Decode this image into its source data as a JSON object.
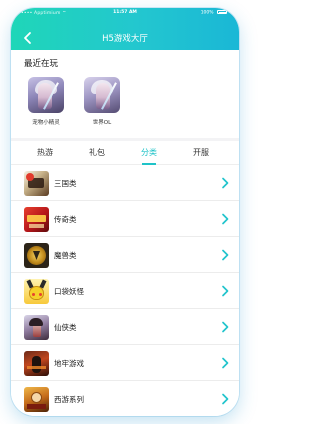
{
  "status_bar": {
    "carrier": "•••• Apptimium ⌔",
    "time": "11:57 AM",
    "battery": "100%"
  },
  "header": {
    "title": "H5游戏大厅",
    "back_icon": "chevron-left-icon"
  },
  "recent": {
    "title": "最近在玩",
    "games": [
      {
        "label": "宠物小精灵"
      },
      {
        "label": "世界OL"
      }
    ]
  },
  "tabs": [
    {
      "label": "热游",
      "active": false
    },
    {
      "label": "礼包",
      "active": false
    },
    {
      "label": "分类",
      "active": true
    },
    {
      "label": "开服",
      "active": false
    }
  ],
  "categories": [
    {
      "label": "三国类",
      "icon": "three-kingdoms-icon"
    },
    {
      "label": "传奇类",
      "icon": "legend-icon"
    },
    {
      "label": "魔兽类",
      "icon": "warcraft-icon"
    },
    {
      "label": "口袋妖怪",
      "icon": "pikachu-icon"
    },
    {
      "label": "仙侠类",
      "icon": "xianxia-icon"
    },
    {
      "label": "地牢游戏",
      "icon": "dungeon-icon"
    },
    {
      "label": "西游系列",
      "icon": "journey-west-icon"
    }
  ],
  "colors": {
    "accent": "#1fc3c8",
    "header_start": "#1fd6b8",
    "header_end": "#1ab7d6",
    "arrow": "#22c4cc"
  }
}
